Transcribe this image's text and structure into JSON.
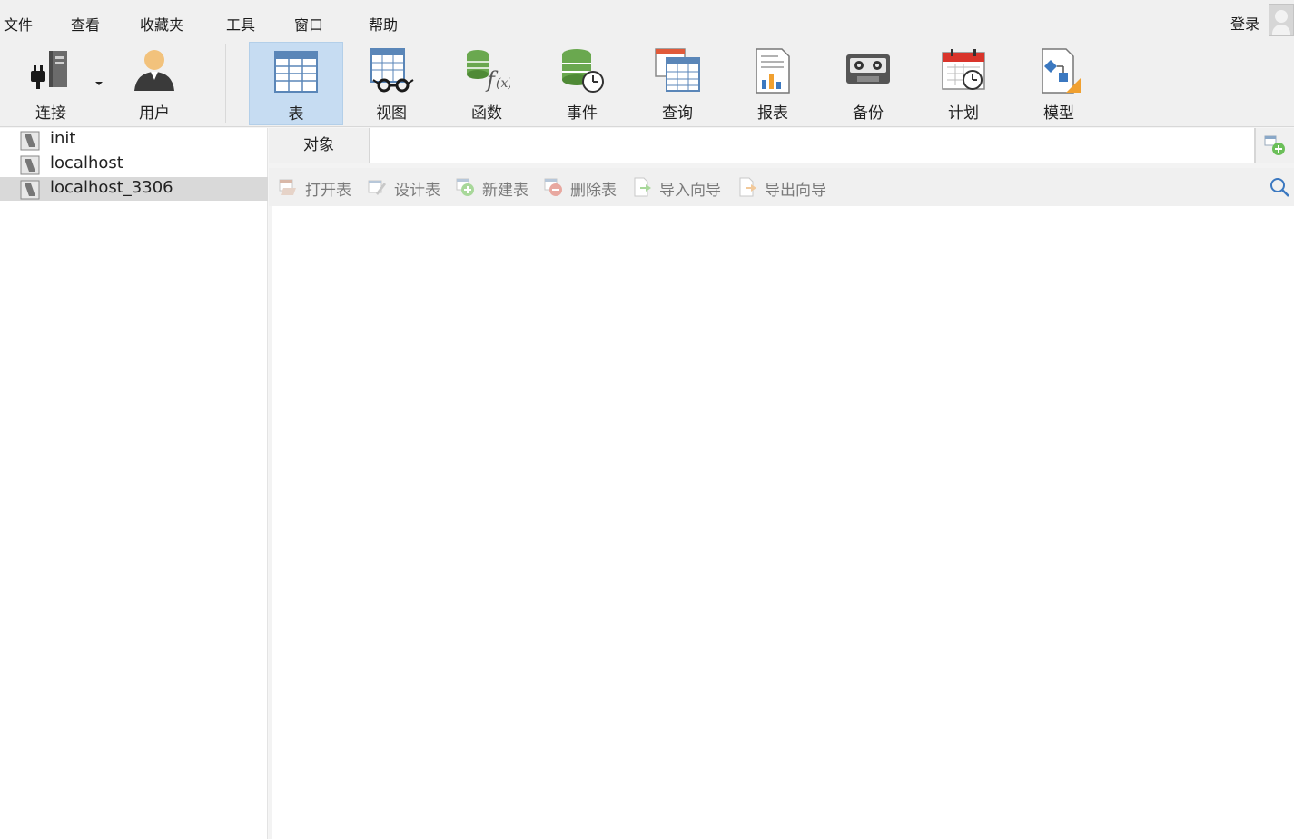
{
  "menu": {
    "items": [
      "文件",
      "查看",
      "收藏夹",
      "工具",
      "窗口",
      "帮助"
    ],
    "login": "登录"
  },
  "toolbar": {
    "items": [
      {
        "label": "连接",
        "icon": "connection-plug-icon"
      },
      {
        "label": "用户",
        "icon": "user-icon"
      },
      {
        "label": "表",
        "icon": "table-icon"
      },
      {
        "label": "视图",
        "icon": "view-glasses-icon"
      },
      {
        "label": "函数",
        "icon": "function-fx-icon"
      },
      {
        "label": "事件",
        "icon": "event-clock-icon"
      },
      {
        "label": "查询",
        "icon": "query-table-icon"
      },
      {
        "label": "报表",
        "icon": "report-chart-icon"
      },
      {
        "label": "备份",
        "icon": "backup-tape-icon"
      },
      {
        "label": "计划",
        "icon": "schedule-calendar-icon"
      },
      {
        "label": "模型",
        "icon": "model-diagram-icon"
      }
    ],
    "active": "表"
  },
  "sidebar": {
    "connections": [
      {
        "label": "init"
      },
      {
        "label": "localhost"
      },
      {
        "label": "localhost_3306"
      }
    ],
    "selected": "localhost_3306"
  },
  "main": {
    "tab_label": "对象",
    "actions": [
      {
        "label": "打开表",
        "icon": "open-table-icon"
      },
      {
        "label": "设计表",
        "icon": "design-table-icon"
      },
      {
        "label": "新建表",
        "icon": "new-table-icon"
      },
      {
        "label": "删除表",
        "icon": "delete-table-icon"
      },
      {
        "label": "导入向导",
        "icon": "import-wizard-icon"
      },
      {
        "label": "导出向导",
        "icon": "export-wizard-icon"
      }
    ]
  },
  "colors": {
    "active_tab": "#c6dcf2",
    "selected_row": "#d9d9d9",
    "disabled_text": "#7a7a7a"
  }
}
